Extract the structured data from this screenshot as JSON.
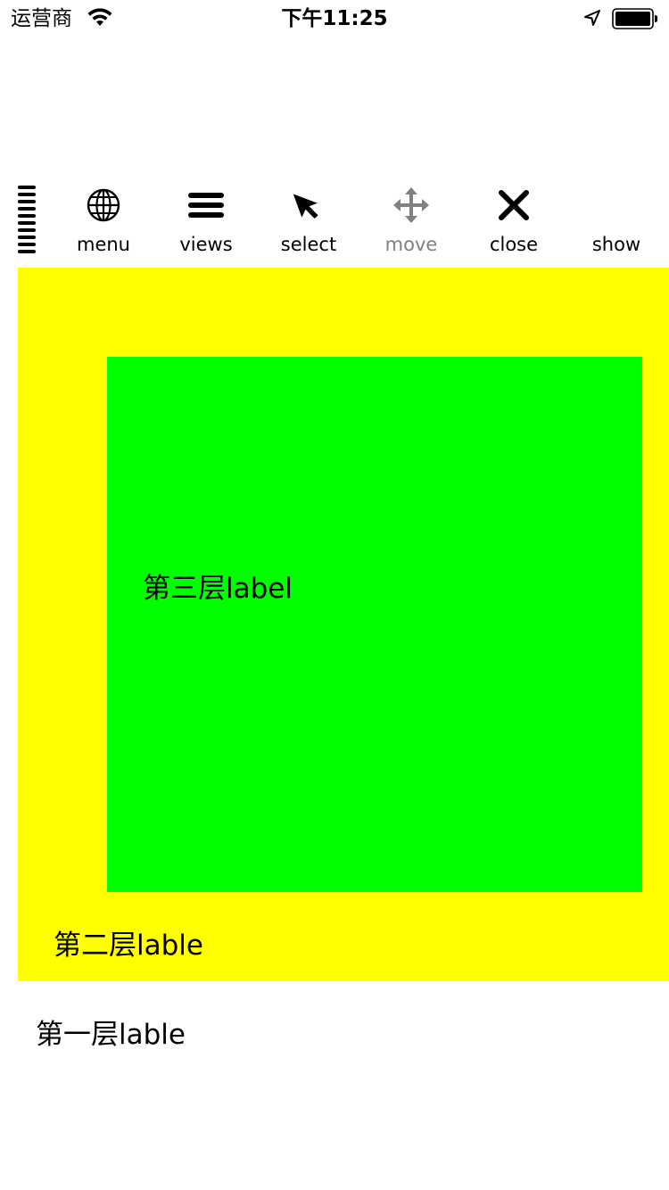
{
  "status_bar": {
    "carrier": "运营商",
    "time": "下午11:25",
    "icons": [
      "wifi-icon",
      "location-arrow-icon",
      "battery-icon"
    ]
  },
  "toolbar": {
    "grip_icon": "drag-grip-icon",
    "items": [
      {
        "label": "menu",
        "icon": "globe-icon",
        "color": "#000000"
      },
      {
        "label": "views",
        "icon": "hamburger-icon",
        "color": "#000000"
      },
      {
        "label": "select",
        "icon": "cursor-arrow-icon",
        "color": "#000000"
      },
      {
        "label": "move",
        "icon": "move-arrows-icon",
        "color": "#808080"
      },
      {
        "label": "close",
        "icon": "close-x-icon",
        "color": "#000000"
      },
      {
        "label": "show",
        "icon": "",
        "color": "#000000"
      }
    ]
  },
  "layers": {
    "layer_one_label": "第一层lable",
    "layer_two_label": "第二层lable",
    "layer_three_label": "第三层label",
    "layer_two_color": "#ffff00",
    "layer_three_color": "#00ff00"
  }
}
